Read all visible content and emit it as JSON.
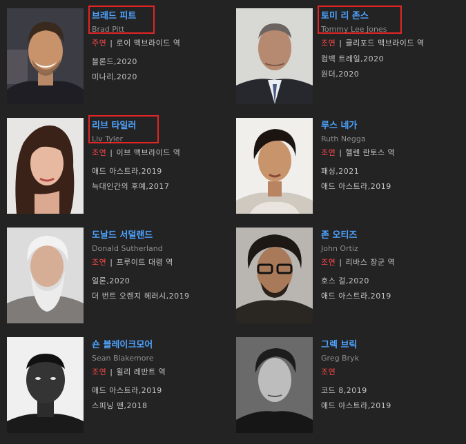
{
  "cast": [
    {
      "name_ko": "브래드 피트",
      "name_en": "Brad Pitt",
      "role_type": "주연",
      "role": "로이 맥브라이드 역",
      "works": [
        "블론드,2020",
        "미나리,2020"
      ],
      "highlighted": true,
      "photo": "smiling-man-dark-hair"
    },
    {
      "name_ko": "토미 리 존스",
      "name_en": "Tommy Lee Jones",
      "role_type": "조연",
      "role": "클리포드 맥브라이드 역",
      "works": [
        "컴백 트레일,2020",
        "원더,2020"
      ],
      "highlighted": true,
      "photo": "older-man-suit"
    },
    {
      "name_ko": "리브 타일러",
      "name_en": "Liv Tyler",
      "role_type": "조연",
      "role": "이브 맥브라이드 역",
      "works": [
        "애드 아스트라,2019",
        "늑대인간의 후예,2017"
      ],
      "highlighted": true,
      "photo": "woman-long-hair"
    },
    {
      "name_ko": "루스 네가",
      "name_en": "Ruth Negga",
      "role_type": "조연",
      "role": "헬렌 란토스 역",
      "works": [
        "패싱,2021",
        "애드 아스트라,2019"
      ],
      "highlighted": false,
      "photo": "woman-short-curly-hair"
    },
    {
      "name_ko": "도날드 서덜랜드",
      "name_en": "Donald Sutherland",
      "role_type": "조연",
      "role": "프루이트 대령 역",
      "works": [
        "얼론,2020",
        "더 번트 오렌지 헤러시,2019"
      ],
      "highlighted": false,
      "photo": "old-man-white-beard"
    },
    {
      "name_ko": "존 오티즈",
      "name_en": "John Ortiz",
      "role_type": "조연",
      "role": "리바스 장군 역",
      "works": [
        "호스 걸,2020",
        "애드 아스트라,2019"
      ],
      "highlighted": false,
      "photo": "man-glasses-curly-hair"
    },
    {
      "name_ko": "숀 블레이크모어",
      "name_en": "Sean Blakemore",
      "role_type": "조연",
      "role": "윌리 레반트 역",
      "works": [
        "애드 아스트라,2019",
        "스피닝 맨,2018"
      ],
      "highlighted": false,
      "photo": "man-bw-portrait"
    },
    {
      "name_ko": "그렉 브릭",
      "name_en": "Greg Bryk",
      "role_type": "조연",
      "role": "",
      "works": [
        "코드 8,2019",
        "애드 아스트라,2019"
      ],
      "highlighted": false,
      "photo": "man-bw-portrait-2"
    }
  ],
  "colors": {
    "background": "#232323",
    "name": "#4ea3ff",
    "role_type": "#ff4a4a",
    "highlight_border": "#e32525"
  }
}
